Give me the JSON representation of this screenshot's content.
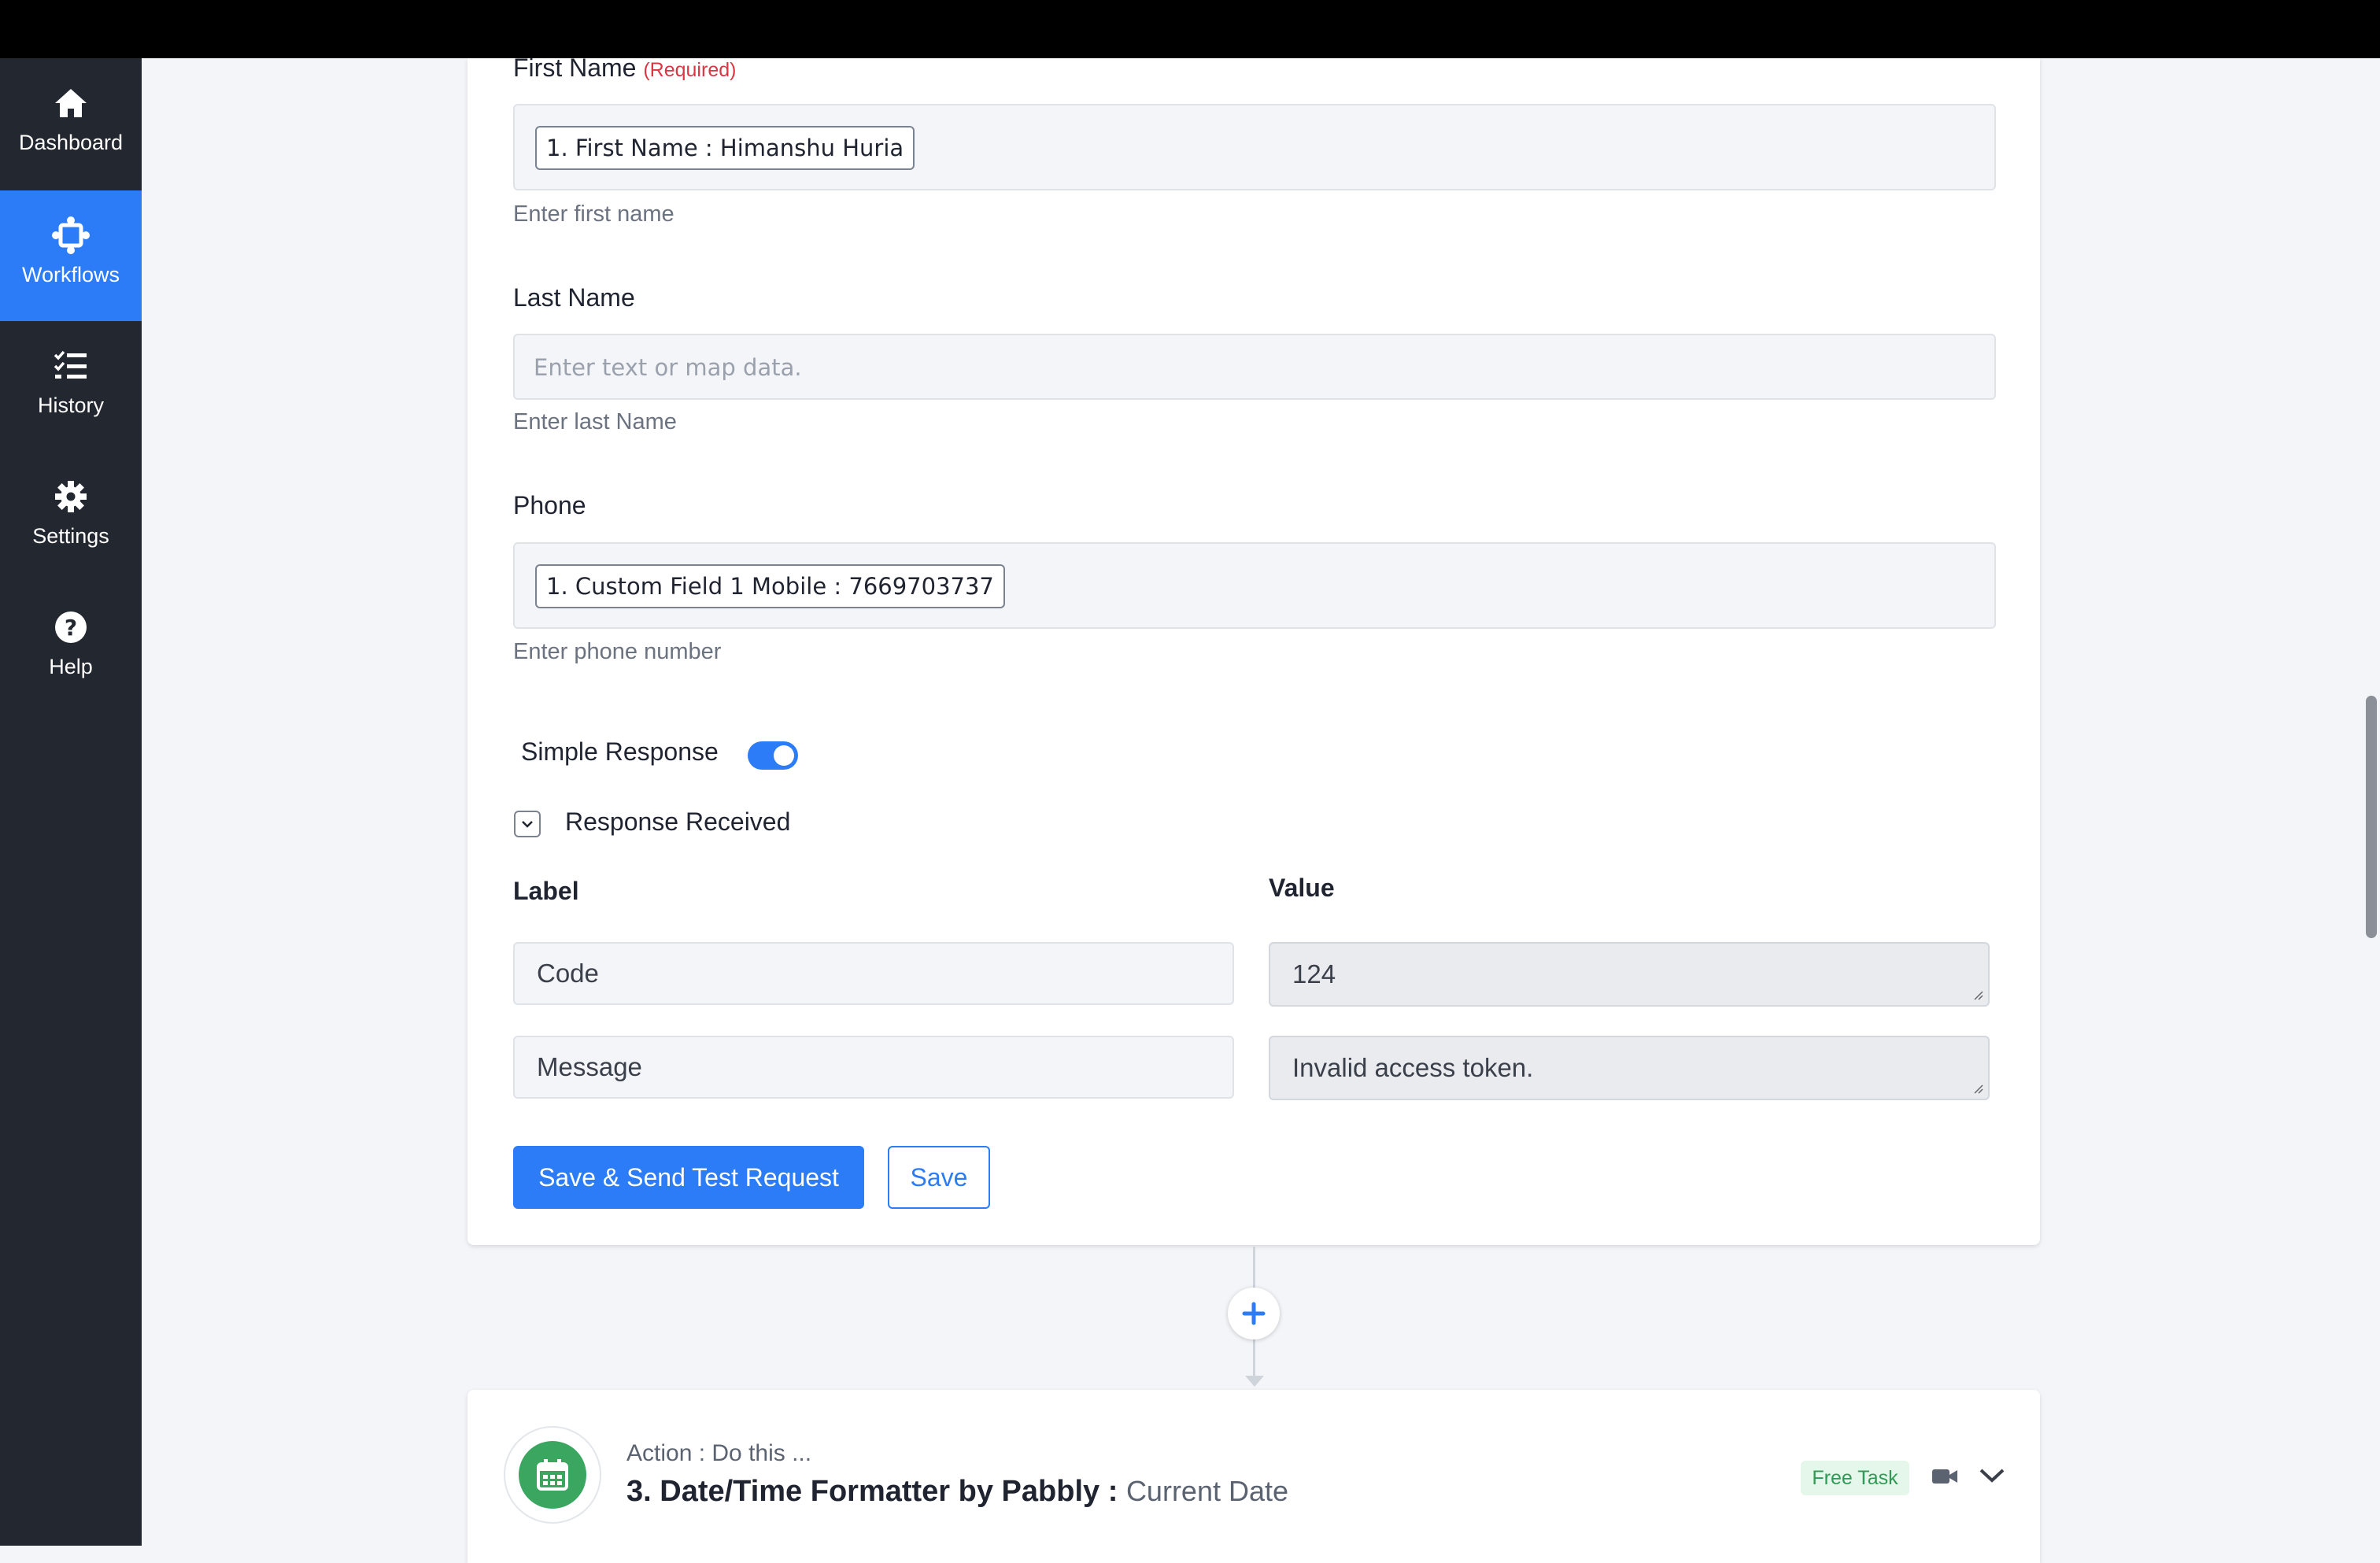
{
  "sidebar": {
    "items": [
      {
        "label": "Dashboard",
        "icon": "home-icon"
      },
      {
        "label": "Workflows",
        "icon": "workflows-icon",
        "active": true
      },
      {
        "label": "History",
        "icon": "history-icon"
      },
      {
        "label": "Settings",
        "icon": "gear-icon"
      },
      {
        "label": "Help",
        "icon": "help-icon"
      }
    ]
  },
  "form": {
    "first_name": {
      "label": "First Name",
      "required": "(Required)",
      "chip": "1. First Name : Himanshu Huria",
      "help": "Enter first name"
    },
    "last_name": {
      "label": "Last Name",
      "placeholder": "Enter text or map data.",
      "help": "Enter last Name"
    },
    "phone": {
      "label": "Phone",
      "chip": "1. Custom Field 1 Mobile : 7669703737",
      "help": "Enter phone number"
    },
    "simple_response": {
      "label": "Simple Response",
      "enabled": true
    },
    "response_received": {
      "label": "Response Received"
    },
    "response_table": {
      "label_header": "Label",
      "value_header": "Value",
      "rows": [
        {
          "label": "Code",
          "value": "124"
        },
        {
          "label": "Message",
          "value": "Invalid access token."
        }
      ]
    },
    "buttons": {
      "save_send": "Save & Send Test Request",
      "save": "Save"
    }
  },
  "next_step": {
    "subtitle": "Action : Do this ...",
    "title": "3. Date/Time Formatter by Pabbly :",
    "event": "Current Date",
    "badge": "Free Task"
  },
  "colors": {
    "accent": "#2b7cf6",
    "sidebar_bg": "#23272f",
    "required": "#d93743",
    "badge_bg": "#e5f6ea",
    "badge_text": "#2f9a55",
    "app_icon": "#3aa660"
  }
}
